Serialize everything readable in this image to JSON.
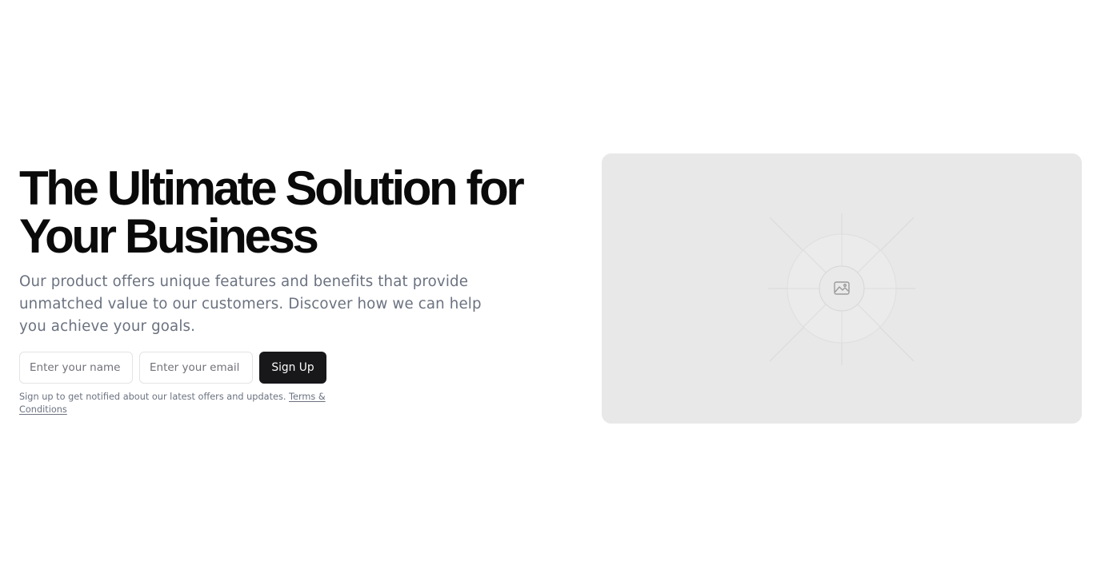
{
  "hero": {
    "headline": "The Ultimate Solution for Your Business",
    "subtext": "Our product offers unique features and benefits that provide unmatched value to our customers. Discover how we can help you achieve your goals.",
    "form": {
      "name_placeholder": "Enter your name",
      "email_placeholder": "Enter your email",
      "submit_label": "Sign Up"
    },
    "notice": {
      "text": "Sign up to get notified about our latest offers and updates.",
      "link_label": "Terms & Conditions"
    },
    "image": {
      "icon": "image-icon"
    }
  },
  "colors": {
    "background": "#ffffff",
    "headline": "#0a0a0b",
    "muted_text": "#6b7280",
    "button_bg": "#18181b",
    "button_text": "#fafafa",
    "placeholder_bg": "#e8e8e8"
  }
}
